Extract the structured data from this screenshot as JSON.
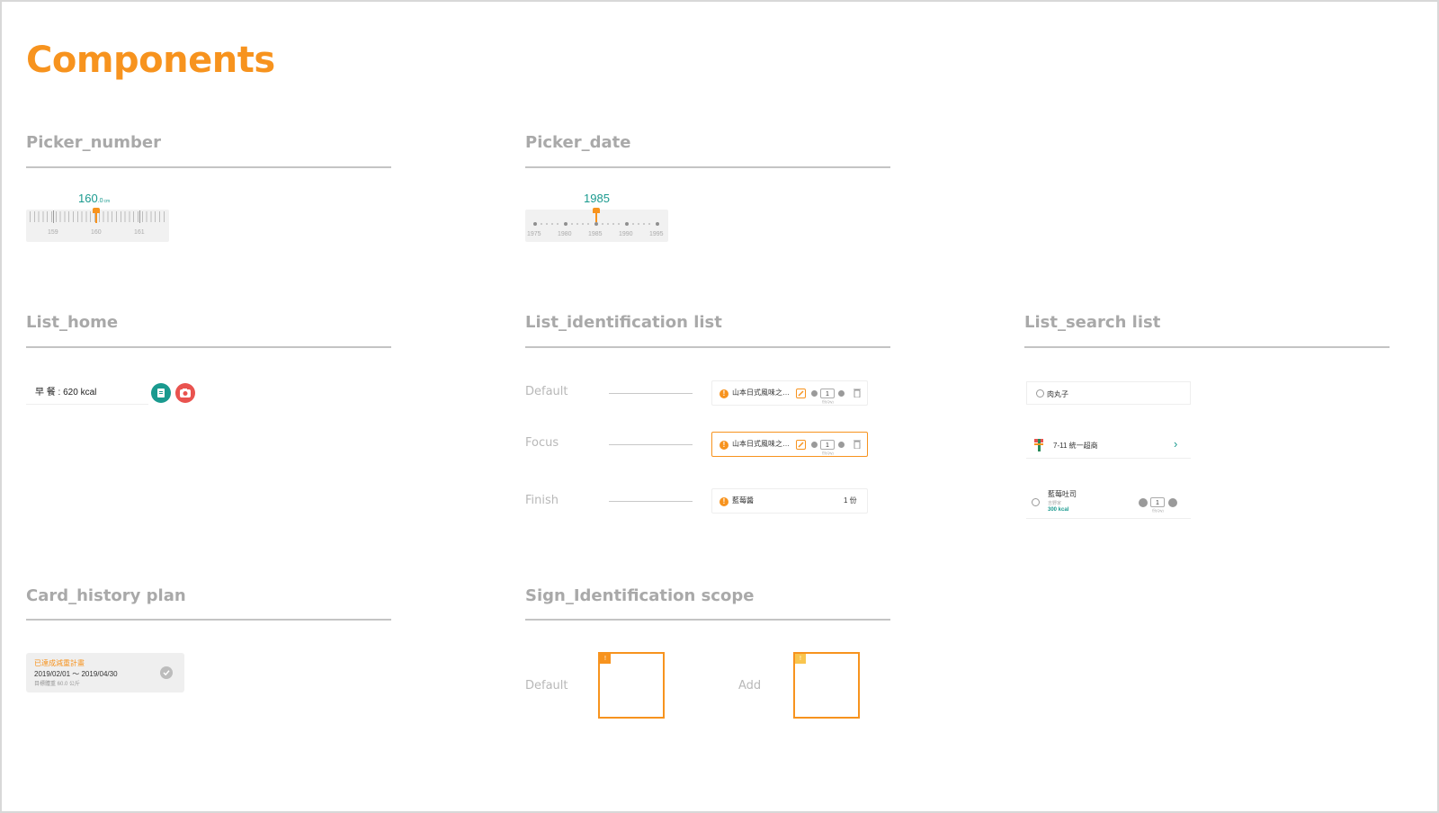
{
  "page_title": "Components",
  "sections": {
    "picker_number": "Picker_number",
    "picker_date": "Picker_date",
    "list_home": "List_home",
    "list_identification": "List_identification list",
    "list_search": "List_search list",
    "card_history": "Card_history plan",
    "sign_identification": "Sign_Identification scope"
  },
  "picker_number": {
    "value": "160",
    "decimal": ".0",
    "unit": "cm",
    "labels": [
      "159",
      "160",
      "161"
    ]
  },
  "picker_date": {
    "value": "1985",
    "labels": [
      "1975",
      "1980",
      "1985",
      "1990",
      "1995"
    ]
  },
  "list_home": {
    "label": "早 餐 : 620 kcal"
  },
  "list_identification": {
    "states": [
      "Default",
      "Focus",
      "Finish"
    ],
    "default_item": "山本日式風味之…",
    "default_qty": "1",
    "default_unit": "份(Qty)",
    "focus_item": "山本日式風味之…",
    "focus_qty": "1",
    "focus_unit": "份(Qty)",
    "finish_item": "藍莓醬",
    "finish_qty": "1 份"
  },
  "list_search": {
    "item1": "肉丸子",
    "item2": "7-11 統一超商",
    "item3_name": "藍莓吐司",
    "item3_sub": "吉野家",
    "item3_kcal": "300 kcal",
    "item3_qty": "1",
    "item3_unit": "份(Qty)"
  },
  "card_history": {
    "title": "已達成減重計畫",
    "dates": "2019/02/01 ～ 2019/04/30",
    "target": "目標體重  60.0 公斤"
  },
  "sign_identification": {
    "default_label": "Default",
    "add_label": "Add",
    "default_tag": "!",
    "add_tag": "!"
  },
  "colors": {
    "accent": "#f7931e",
    "teal": "#1a9a8f",
    "red": "#e9534f",
    "section_title": "#a9a9a9"
  }
}
